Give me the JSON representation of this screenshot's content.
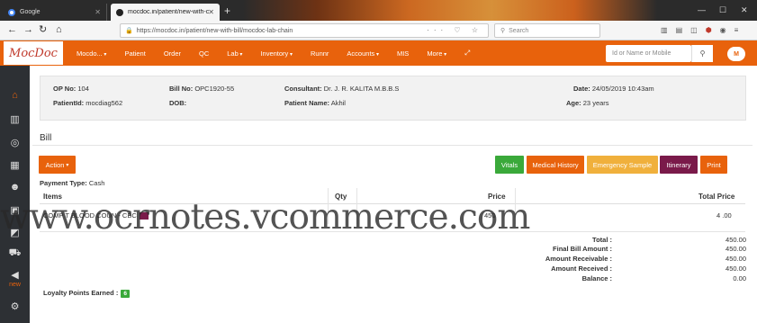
{
  "browser": {
    "tabs": [
      {
        "title": "Google",
        "active": false
      },
      {
        "title": "mocdoc.in/patient/new-with-c",
        "active": true
      }
    ],
    "new_tab": "+",
    "url": "https://mocdoc.in/patient/new-with-bill/mocdoc-lab-chain",
    "search_placeholder": "Search"
  },
  "app": {
    "logo": "MocDoc",
    "menu": [
      {
        "label": "Mocdo...",
        "dropdown": true
      },
      {
        "label": "Patient",
        "dropdown": false
      },
      {
        "label": "Order",
        "dropdown": false
      },
      {
        "label": "QC",
        "dropdown": false
      },
      {
        "label": "Lab",
        "dropdown": true
      },
      {
        "label": "Inventory",
        "dropdown": true
      },
      {
        "label": "Runnr",
        "dropdown": false
      },
      {
        "label": "Accounts",
        "dropdown": true
      },
      {
        "label": "MIS",
        "dropdown": false
      },
      {
        "label": "More",
        "dropdown": true
      }
    ],
    "search_placeholder": "Id or Name or Mobile",
    "avatar_initial": "M",
    "accent": "#e8620c"
  },
  "sidebar": {
    "icons": [
      "home-icon",
      "bar-chart-icon",
      "target-icon",
      "calendar-icon",
      "users-icon",
      "picture-icon",
      "image-icon",
      "cart-icon",
      "megaphone-icon",
      "gear-icon"
    ],
    "new_label": "new"
  },
  "patient": {
    "op_no_label": "OP No:",
    "op_no": "104",
    "bill_no_label": "Bill No:",
    "bill_no": "OPC1920-55",
    "consultant_label": "Consultant:",
    "consultant": "Dr. J. R. KALITA M.B.B.S",
    "date_label": "Date:",
    "date": "24/05/2019 10:43am",
    "patient_id_label": "PatientId:",
    "patient_id": "mocdiag562",
    "dob_label": "DOB:",
    "dob": "",
    "patient_name_label": "Patient Name:",
    "patient_name": "Akhil",
    "age_label": "Age:",
    "age": "23 years"
  },
  "bill": {
    "title": "Bill",
    "action_label": "Action",
    "buttons": [
      {
        "label": "Vitals",
        "color": "#3aa93a"
      },
      {
        "label": "Medical History",
        "color": "#e8620c"
      },
      {
        "label": "Emergency Sample",
        "color": "#f0b03c"
      },
      {
        "label": "Itinerary",
        "color": "#7a1a4a"
      },
      {
        "label": "Print",
        "color": "#e8620c"
      }
    ],
    "payment_type_label": "Payment Type:",
    "payment_type": "Cash",
    "columns": {
      "items": "Items",
      "qty": "Qty",
      "price": "Price",
      "total": "Total Price"
    },
    "rows": [
      {
        "item": "COMP  T  BLOOD COUN  - CBC",
        "qty": "",
        "price": "450",
        "total": "4 .00"
      }
    ],
    "summary": {
      "total_label": "Total :",
      "total": "450.00",
      "final_label": "Final Bill Amount :",
      "final": "450.00",
      "receivable_label": "Amount Receivable :",
      "receivable": "450.00",
      "received_label": "Amount Received :",
      "received": "450.00",
      "balance_label": "Balance :",
      "balance": "0.00"
    },
    "loyalty_label": "Loyalty Points Earned :",
    "loyalty_points": "6"
  },
  "watermark": "www.ocrnotes.vcommerce.com"
}
